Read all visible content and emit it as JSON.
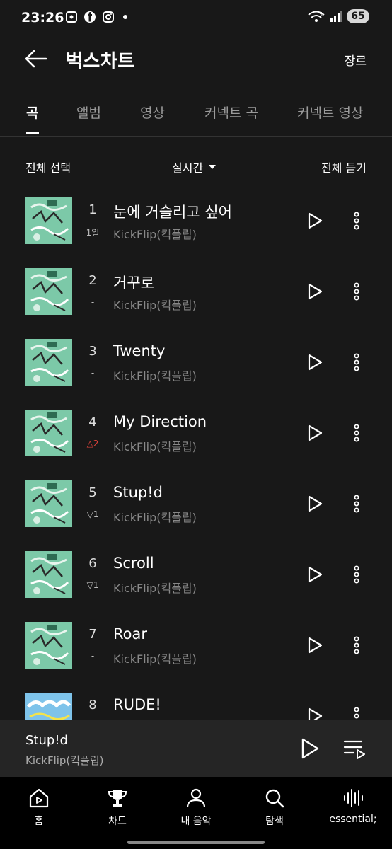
{
  "status_bar": {
    "time": "23:26",
    "battery": "65",
    "signal_label": "5"
  },
  "header": {
    "title": "벅스차트",
    "genre_label": "장르"
  },
  "tabs": [
    {
      "label": "곡",
      "active": true
    },
    {
      "label": "앨범",
      "active": false
    },
    {
      "label": "영상",
      "active": false
    },
    {
      "label": "커넥트 곡",
      "active": false
    },
    {
      "label": "커넥트 영상",
      "active": false
    }
  ],
  "toolbar": {
    "select_all": "전체 선택",
    "filter": "실시간",
    "play_all": "전체 듣기"
  },
  "songs": [
    {
      "rank": "1",
      "change": "1일",
      "title": "눈에 거슬리고 싶어",
      "artist": "KickFlip(킥플립)",
      "cover": "my-first-flip"
    },
    {
      "rank": "2",
      "change": "-",
      "title": "거꾸로",
      "artist": "KickFlip(킥플립)",
      "cover": "my-first-flip"
    },
    {
      "rank": "3",
      "change": "-",
      "title": "Twenty",
      "artist": "KickFlip(킥플립)",
      "cover": "my-first-flip"
    },
    {
      "rank": "4",
      "change": "△2",
      "title": "My Direction",
      "artist": "KickFlip(킥플립)",
      "cover": "my-first-flip"
    },
    {
      "rank": "5",
      "change": "▽1",
      "title": "Stup!d",
      "artist": "KickFlip(킥플립)",
      "cover": "my-first-flip"
    },
    {
      "rank": "6",
      "change": "▽1",
      "title": "Scroll",
      "artist": "KickFlip(킥플립)",
      "cover": "my-first-flip"
    },
    {
      "rank": "7",
      "change": "-",
      "title": "Roar",
      "artist": "KickFlip(킥플립)",
      "cover": "my-first-flip"
    },
    {
      "rank": "8",
      "change": "",
      "title": "RUDE!",
      "artist": "",
      "cover": "rude"
    }
  ],
  "mini_player": {
    "title": "Stup!d",
    "artist": "KickFlip(킥플립)"
  },
  "bottom_nav": [
    {
      "label": "홈",
      "icon": "home-icon"
    },
    {
      "label": "차트",
      "icon": "trophy-icon"
    },
    {
      "label": "내 음악",
      "icon": "person-icon"
    },
    {
      "label": "탐색",
      "icon": "search-icon"
    },
    {
      "label": "essential;",
      "icon": "waveform-icon"
    }
  ],
  "colors": {
    "background": "#181818",
    "rank_up": "#e0433b",
    "cover_green": "#7cc9a8",
    "cover_blue": "#7ec3ea"
  }
}
